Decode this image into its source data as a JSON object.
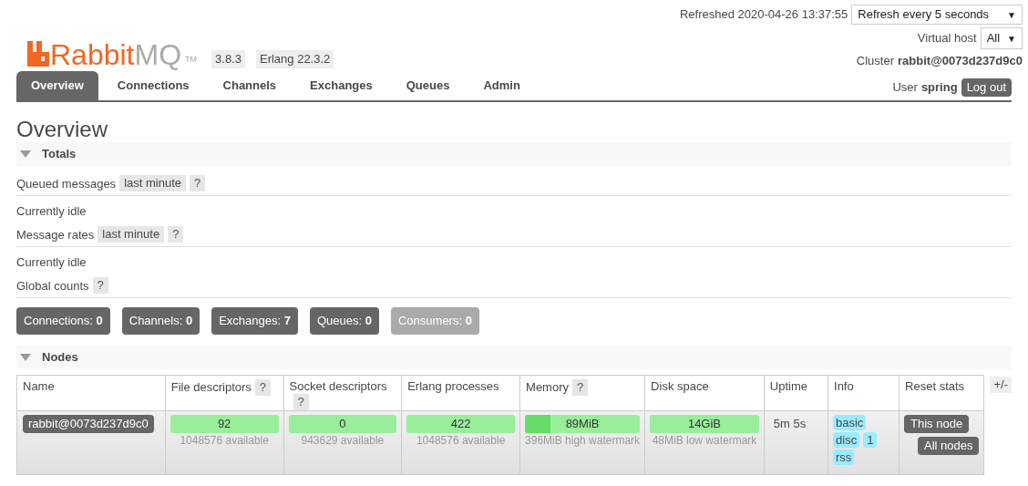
{
  "header": {
    "logo_main": "Rabbit",
    "logo_suffix": "MQ",
    "logo_tm": "TM",
    "version": "3.8.3",
    "erlang": "Erlang 22.3.2",
    "refreshed": "Refreshed 2020-04-26 13:37:55",
    "refresh_select": "Refresh every 5 seconds",
    "select_caret": "▼",
    "vhost_label": "Virtual host",
    "vhost_select": "All",
    "cluster_label": "Cluster",
    "cluster": "rabbit@0073d237d9c0",
    "user_label": "User",
    "user": "spring",
    "logout": "Log out"
  },
  "tabs": [
    {
      "label": "Overview",
      "selected": true
    },
    {
      "label": "Connections",
      "selected": false
    },
    {
      "label": "Channels",
      "selected": false
    },
    {
      "label": "Exchanges",
      "selected": false
    },
    {
      "label": "Queues",
      "selected": false
    },
    {
      "label": "Admin",
      "selected": false
    }
  ],
  "page_title": "Overview",
  "totals": {
    "title": "Totals",
    "expanded": true,
    "rows": [
      {
        "label": "Queued messages",
        "range": "last minute",
        "help": "?",
        "status": "Currently idle"
      },
      {
        "label": "Message rates",
        "range": "last minute",
        "help": "?",
        "status": "Currently idle"
      }
    ],
    "global_label": "Global counts",
    "global_help": "?",
    "counts": [
      {
        "label": "Connections:",
        "value": "0",
        "disabled": false
      },
      {
        "label": "Channels:",
        "value": "0",
        "disabled": false
      },
      {
        "label": "Exchanges:",
        "value": "7",
        "disabled": false
      },
      {
        "label": "Queues:",
        "value": "0",
        "disabled": false
      },
      {
        "label": "Consumers:",
        "value": "0",
        "disabled": true
      }
    ]
  },
  "nodes": {
    "title": "Nodes",
    "expanded": true,
    "toggle_columns": "+/-",
    "columns": [
      {
        "label": "Name"
      },
      {
        "label": "File descriptors",
        "help": "?"
      },
      {
        "label": "Socket descriptors",
        "help": "?"
      },
      {
        "label": "Erlang processes"
      },
      {
        "label": "Memory",
        "help": "?"
      },
      {
        "label": "Disk space"
      },
      {
        "label": "Uptime"
      },
      {
        "label": "Info"
      },
      {
        "label": "Reset stats"
      }
    ],
    "rows": [
      {
        "name": "rabbit@0073d237d9c0",
        "file_descriptors": {
          "value": "92",
          "note": "1048576 available"
        },
        "socket_descriptors": {
          "value": "0",
          "note": "943629 available"
        },
        "erlang_processes": {
          "value": "422",
          "note": "1048576 available"
        },
        "memory": {
          "value": "89MiB",
          "note": "396MiB high watermark",
          "level": 0.22
        },
        "disk_space": {
          "value": "14GiB",
          "note": "48MiB low watermark"
        },
        "uptime": "5m 5s",
        "info": [
          {
            "label": "basic"
          },
          {
            "label": "disc",
            "count": "1"
          },
          {
            "label": "rss"
          }
        ],
        "reset": [
          "This node",
          "All nodes"
        ]
      }
    ]
  }
}
